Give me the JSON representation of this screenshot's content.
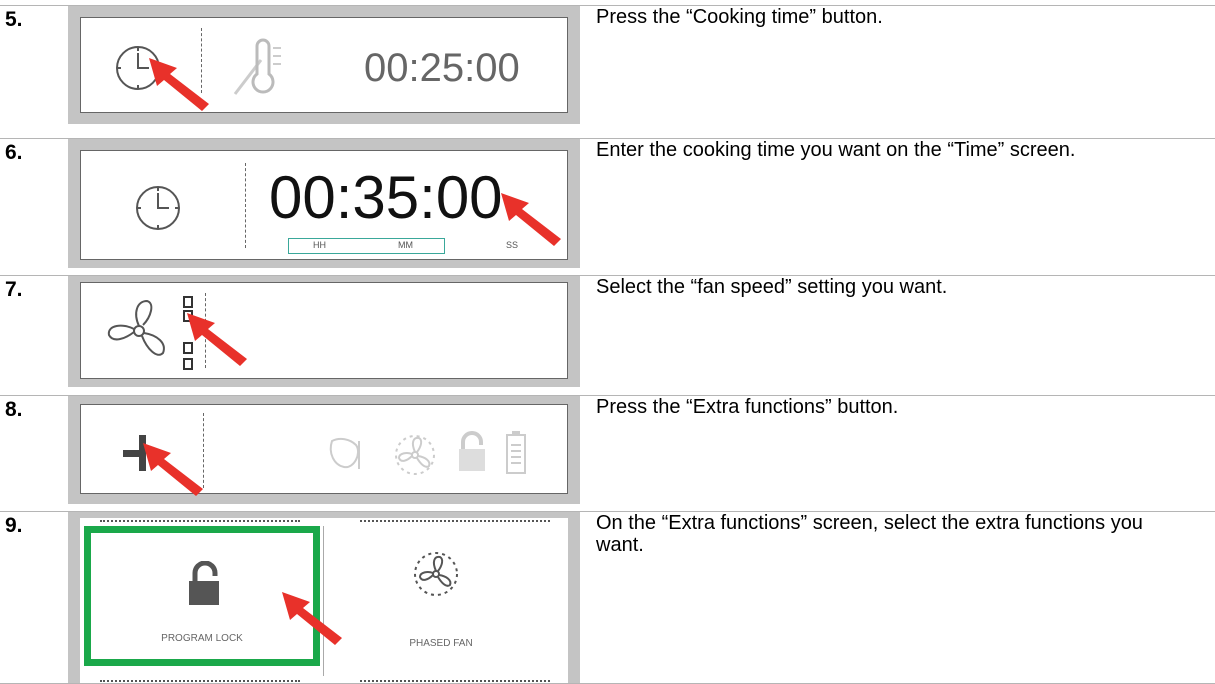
{
  "steps": [
    {
      "number": "5.",
      "text": "Press the “Cooking time” button."
    },
    {
      "number": "6.",
      "text": "Enter the cooking time you want on the “Time” screen."
    },
    {
      "number": "7.",
      "text": "Select the “fan speed” setting you want."
    },
    {
      "number": "8.",
      "text": "Press the “Extra functions” button."
    },
    {
      "number": "9.",
      "text": "On the “Extra functions” screen, select the extra functions you want."
    }
  ],
  "screen5": {
    "time": "00:25:00"
  },
  "screen6": {
    "time": "00:35:00",
    "hh": "HH",
    "mm": "MM",
    "ss": "SS"
  },
  "screen9": {
    "left_label": "PROGRAM LOCK",
    "right_label": "PHASED FAN"
  },
  "colors": {
    "arrow": "#e8312a",
    "highlight": "#1aa84a",
    "border": "#b5b5b5",
    "frame": "#c4c4c4"
  }
}
